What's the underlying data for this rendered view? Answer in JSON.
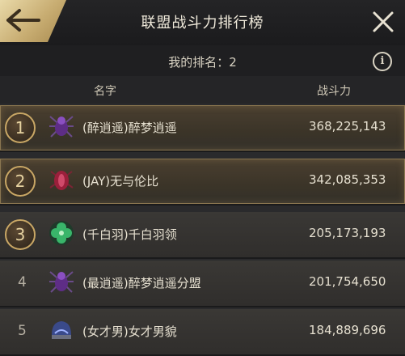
{
  "header": {
    "title": "联盟战斗力排行榜"
  },
  "my_rank": {
    "text": "我的排名：2"
  },
  "columns": {
    "name": "名字",
    "power": "战斗力"
  },
  "icons": {
    "back": "back-arrow-icon",
    "close": "close-icon",
    "info": "info-icon"
  },
  "rows": [
    {
      "rank": "1",
      "name": "(醉逍遥)醉梦逍遥",
      "power": "368,225,143",
      "emblem": "purple-spider-emblem"
    },
    {
      "rank": "2",
      "name": "(JAY)无与伦比",
      "power": "342,085,353",
      "emblem": "crimson-beetle-emblem"
    },
    {
      "rank": "3",
      "name": "(千白羽)千白羽领",
      "power": "205,173,193",
      "emblem": "green-clover-emblem"
    },
    {
      "rank": "4",
      "name": "(最逍遥)醉梦逍遥分盟",
      "power": "201,754,650",
      "emblem": "purple-spider-emblem"
    },
    {
      "rank": "5",
      "name": "(女才男)女才男貌",
      "power": "184,889,696",
      "emblem": "blue-helmet-emblem"
    }
  ]
}
